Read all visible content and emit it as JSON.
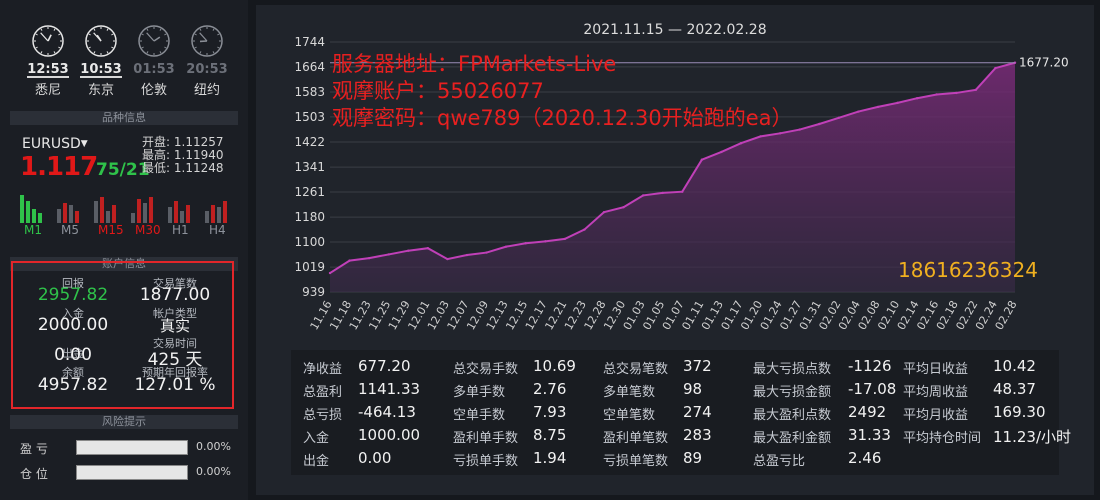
{
  "clocks": [
    {
      "time": "12:53",
      "city": "悉尼",
      "active": true,
      "h": 12,
      "m": 53
    },
    {
      "time": "10:53",
      "city": "东京",
      "active": true,
      "h": 10,
      "m": 53
    },
    {
      "time": "01:53",
      "city": "伦敦",
      "active": false,
      "h": 1,
      "m": 53
    },
    {
      "time": "20:53",
      "city": "纽约",
      "active": false,
      "h": 20,
      "m": 53
    }
  ],
  "product": {
    "section_title": "品种信息",
    "symbol": "EURUSD",
    "price_main": "1.117",
    "price_tail": "75/21",
    "open_label": "开盘:",
    "open": "1.11257",
    "high_label": "最高:",
    "high": "1.11940",
    "low_label": "最低:",
    "low": "1.11248",
    "timeframes": [
      "M1",
      "M5",
      "M15",
      "M30",
      "H1",
      "H4"
    ],
    "timeframe_colors": [
      "#2fc24a",
      "#8d929b",
      "#e01818",
      "#e01818",
      "#8d929b",
      "#8d929b"
    ]
  },
  "account": {
    "section_title": "账户信息",
    "return_label": "回报",
    "return_value": "2957.82",
    "trades_label": "交易笔数",
    "trades_value": "1877.00",
    "deposit_label": "入金",
    "deposit_value": "2000.00",
    "type_label": "帐户类型",
    "type_value": "真实",
    "withdraw_label": "出金",
    "withdraw_value": "0.00",
    "time_label": "交易时间",
    "time_value": "425 天",
    "balance_label": "余额",
    "balance_value": "4957.82",
    "annual_label": "预期年回报率",
    "annual_value": "127.01 %"
  },
  "risk": {
    "section_title": "风险提示",
    "pl_label": "盈  亏",
    "pl_value": "0.00%",
    "pos_label": "仓  位",
    "pos_value": "0.00%"
  },
  "overlay_lines": [
    "服务器地址：FPMarkets-Live",
    "观摩账户：55026077",
    "观摩密码：qwe789（2020.12.30开始跑的ea）"
  ],
  "phone": "18616236324",
  "chart_data": {
    "type": "area",
    "title": "2021.11.15 — 2022.02.28",
    "ylim": [
      939,
      1744
    ],
    "yticks": [
      1744,
      1664,
      1583,
      1503,
      1422,
      1341,
      1261,
      1180,
      1100,
      1019,
      939
    ],
    "last_value_label": "1677.20",
    "grid": true,
    "line_color": "#c040b8",
    "xticks": [
      "11.16",
      "11.18",
      "11.23",
      "11.25",
      "11.29",
      "12.01",
      "12.03",
      "12.07",
      "12.09",
      "12.13",
      "12.15",
      "12.17",
      "12.21",
      "12.23",
      "12.28",
      "12.30",
      "01.03",
      "01.05",
      "01.07",
      "01.11",
      "01.13",
      "01.17",
      "01.20",
      "01.24",
      "01.27",
      "01.31",
      "02.02",
      "02.04",
      "02.08",
      "02.10",
      "02.14",
      "02.16",
      "02.18",
      "02.22",
      "02.24",
      "02.28"
    ],
    "values": [
      1000,
      1040,
      1048,
      1060,
      1072,
      1080,
      1045,
      1058,
      1066,
      1085,
      1096,
      1102,
      1110,
      1140,
      1196,
      1212,
      1250,
      1258,
      1262,
      1365,
      1390,
      1418,
      1440,
      1450,
      1462,
      1480,
      1500,
      1520,
      1535,
      1548,
      1563,
      1575,
      1580,
      1590,
      1660,
      1677.2
    ]
  },
  "stats": {
    "col1": [
      {
        "k": "净收益",
        "v": "677.20"
      },
      {
        "k": "总盈利",
        "v": "1141.33"
      },
      {
        "k": "总亏损",
        "v": "-464.13"
      },
      {
        "k": "入金",
        "v": "1000.00"
      },
      {
        "k": "出金",
        "v": "0.00"
      }
    ],
    "col2": [
      {
        "k": "总交易手数",
        "v": "10.69"
      },
      {
        "k": "多单手数",
        "v": "2.76"
      },
      {
        "k": "空单手数",
        "v": "7.93"
      },
      {
        "k": "盈利单手数",
        "v": "8.75"
      },
      {
        "k": "亏损单手数",
        "v": "1.94"
      }
    ],
    "col3": [
      {
        "k": "总交易笔数",
        "v": "372"
      },
      {
        "k": "多单笔数",
        "v": "98"
      },
      {
        "k": "空单笔数",
        "v": "274"
      },
      {
        "k": "盈利单笔数",
        "v": "283"
      },
      {
        "k": "亏损单笔数",
        "v": "89"
      }
    ],
    "col4": [
      {
        "k": "最大亏损点数",
        "v": "-1126"
      },
      {
        "k": "最大亏损金额",
        "v": "-17.08"
      },
      {
        "k": "最大盈利点数",
        "v": "2492"
      },
      {
        "k": "最大盈利金额",
        "v": "31.33"
      },
      {
        "k": "总盈亏比",
        "v": "2.46"
      }
    ],
    "col5": [
      {
        "k": "平均日收益",
        "v": "10.42"
      },
      {
        "k": "平均周收益",
        "v": "48.37"
      },
      {
        "k": "平均月收益",
        "v": "169.30"
      },
      {
        "k": "平均持仓时间",
        "v": "11.23/小时"
      }
    ]
  }
}
